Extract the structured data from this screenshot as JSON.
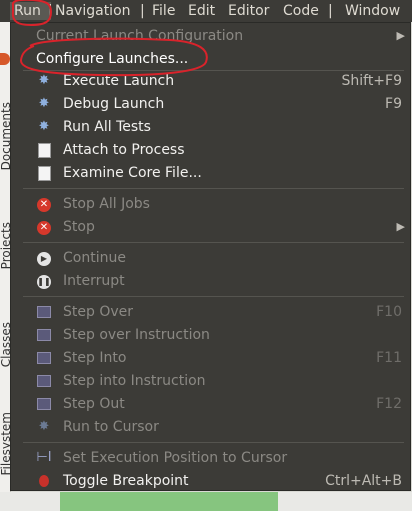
{
  "menubar": {
    "items": [
      "Run",
      "Navigation",
      "File",
      "Edit",
      "Editor",
      "Code",
      "Window"
    ]
  },
  "sidepanel": {
    "tabs": [
      "Documents",
      "Projects",
      "Classes",
      "Filesystem"
    ]
  },
  "menu": {
    "items": [
      {
        "label": "Current Launch Configuration",
        "accel": "",
        "submenu": true,
        "disabled": true,
        "icon": ""
      },
      {
        "label": "Configure Launches...",
        "accel": "",
        "submenu": false,
        "disabled": false,
        "icon": ""
      },
      {
        "label": "Execute Launch",
        "accel": "Shift+F9",
        "submenu": false,
        "disabled": false,
        "icon": "gear-icon"
      },
      {
        "label": "Debug Launch",
        "accel": "F9",
        "submenu": false,
        "disabled": false,
        "icon": "gear-icon"
      },
      {
        "label": "Run All Tests",
        "accel": "",
        "submenu": false,
        "disabled": false,
        "icon": "gear-icon"
      },
      {
        "label": "Attach to Process",
        "accel": "",
        "submenu": false,
        "disabled": false,
        "icon": "document-icon"
      },
      {
        "label": "Examine Core File...",
        "accel": "",
        "submenu": false,
        "disabled": false,
        "icon": "document-icon"
      },
      {
        "label": "Stop All Jobs",
        "accel": "",
        "submenu": false,
        "disabled": true,
        "icon": "stop-icon"
      },
      {
        "label": "Stop",
        "accel": "",
        "submenu": true,
        "disabled": true,
        "icon": "stop-icon"
      },
      {
        "label": "Continue",
        "accel": "",
        "submenu": false,
        "disabled": true,
        "icon": "play-icon"
      },
      {
        "label": "Interrupt",
        "accel": "",
        "submenu": false,
        "disabled": true,
        "icon": "pause-icon"
      },
      {
        "label": "Step Over",
        "accel": "F10",
        "submenu": false,
        "disabled": true,
        "icon": "step-over-icon"
      },
      {
        "label": "Step over Instruction",
        "accel": "",
        "submenu": false,
        "disabled": true,
        "icon": "step-over-instruction-icon"
      },
      {
        "label": "Step Into",
        "accel": "F11",
        "submenu": false,
        "disabled": true,
        "icon": "step-into-icon"
      },
      {
        "label": "Step into Instruction",
        "accel": "",
        "submenu": false,
        "disabled": true,
        "icon": "step-into-instruction-icon"
      },
      {
        "label": "Step Out",
        "accel": "F12",
        "submenu": false,
        "disabled": true,
        "icon": "step-out-icon"
      },
      {
        "label": "Run to Cursor",
        "accel": "",
        "submenu": false,
        "disabled": true,
        "icon": "run-to-cursor-icon"
      },
      {
        "label": "Set Execution Position to Cursor",
        "accel": "",
        "submenu": false,
        "disabled": true,
        "icon": "bracket-icon"
      },
      {
        "label": "Toggle Breakpoint",
        "accel": "Ctrl+Alt+B",
        "submenu": false,
        "disabled": false,
        "icon": "bug-icon"
      }
    ]
  },
  "colors": {
    "menu_bg": "#3c3b37",
    "annotation": "#d9232b",
    "statusbar_green": "#86c57f"
  }
}
